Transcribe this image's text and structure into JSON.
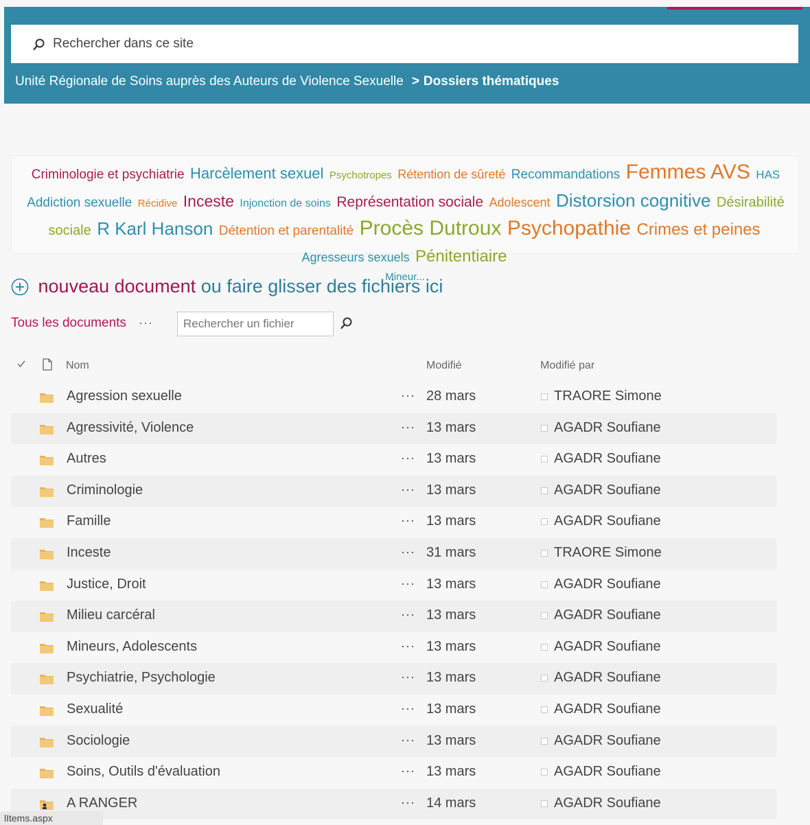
{
  "header": {
    "search_placeholder": "Rechercher dans ce site",
    "breadcrumb_site": "Unité Régionale de Soins auprès des Auteurs de Violence Sexuelle",
    "breadcrumb_sep": ">",
    "breadcrumb_current": "Dossiers thématiques"
  },
  "tagcloud": {
    "tags": [
      {
        "text": "Criminologie et psychiatrie",
        "size": 19,
        "color": "#a81d4c"
      },
      {
        "text": "Harcèlement sexuel",
        "size": 22,
        "color": "#2e8fad"
      },
      {
        "text": "Psychotropes",
        "size": 15,
        "color": "#8aa82c"
      },
      {
        "text": "Rétention de sûreté",
        "size": 18,
        "color": "#e0782a"
      },
      {
        "text": "Recommandations",
        "size": 19,
        "color": "#2e8fad"
      },
      {
        "text": "Femmes AVS",
        "size": 30,
        "color": "#e0782a"
      },
      {
        "text": "HAS",
        "size": 17,
        "color": "#2e8fad"
      },
      {
        "text": "Addiction sexuelle",
        "size": 19,
        "color": "#2e8fad"
      },
      {
        "text": "Récidive",
        "size": 15,
        "color": "#e0782a"
      },
      {
        "text": "Inceste",
        "size": 23,
        "color": "#a81d4c"
      },
      {
        "text": "Injonction de soins",
        "size": 16,
        "color": "#2e8fad"
      },
      {
        "text": "Représentation sociale",
        "size": 21,
        "color": "#a81d4c"
      },
      {
        "text": "Adolescent",
        "size": 18,
        "color": "#e0782a"
      },
      {
        "text": "Distorsion cognitive",
        "size": 26,
        "color": "#2e8fad"
      },
      {
        "text": "Désirabilité sociale",
        "size": 20,
        "color": "#8aa82c"
      },
      {
        "text": "R Karl Hanson",
        "size": 26,
        "color": "#2e8fad"
      },
      {
        "text": "Détention et parentalité",
        "size": 19,
        "color": "#e0782a"
      },
      {
        "text": "Procès Dutroux",
        "size": 30,
        "color": "#8aa82c"
      },
      {
        "text": "Psychopathie",
        "size": 30,
        "color": "#e0782a"
      },
      {
        "text": "Crimes et peines",
        "size": 24,
        "color": "#e0782a"
      },
      {
        "text": "Agresseurs sexuels",
        "size": 18,
        "color": "#2e8fad"
      },
      {
        "text": "Pénitentiaire",
        "size": 24,
        "color": "#8aa82c"
      }
    ],
    "more_label": "Mineur..."
  },
  "library": {
    "new_doc_label": "nouveau document",
    "drag_label": "ou faire glisser des fichiers ici",
    "view_label": "Tous les documents",
    "more_views": "···",
    "file_search_placeholder": "Rechercher un fichier"
  },
  "columns": {
    "name": "Nom",
    "modified": "Modifié",
    "modified_by": "Modifié par"
  },
  "rows": [
    {
      "name": "Agression sexuelle",
      "date": "28 mars",
      "user": "TRAORE Simone",
      "icon": "folder-icon"
    },
    {
      "name": "Agressivité, Violence",
      "date": "13 mars",
      "user": "AGADR Soufiane",
      "icon": "folder-icon"
    },
    {
      "name": "Autres",
      "date": "13 mars",
      "user": "AGADR Soufiane",
      "icon": "folder-icon"
    },
    {
      "name": "Criminologie",
      "date": "13 mars",
      "user": "AGADR Soufiane",
      "icon": "folder-icon"
    },
    {
      "name": "Famille",
      "date": "13 mars",
      "user": "AGADR Soufiane",
      "icon": "folder-icon"
    },
    {
      "name": "Inceste",
      "date": "31 mars",
      "user": "TRAORE Simone",
      "icon": "folder-icon"
    },
    {
      "name": "Justice, Droit",
      "date": "13 mars",
      "user": "AGADR Soufiane",
      "icon": "folder-icon"
    },
    {
      "name": "Milieu carcéral",
      "date": "13 mars",
      "user": "AGADR Soufiane",
      "icon": "folder-icon"
    },
    {
      "name": "Mineurs, Adolescents",
      "date": "13 mars",
      "user": "AGADR Soufiane",
      "icon": "folder-icon"
    },
    {
      "name": "Psychiatrie, Psychologie",
      "date": "13 mars",
      "user": "AGADR Soufiane",
      "icon": "folder-icon"
    },
    {
      "name": "Sexualité",
      "date": "13 mars",
      "user": "AGADR Soufiane",
      "icon": "folder-icon"
    },
    {
      "name": "Sociologie",
      "date": "13 mars",
      "user": "AGADR Soufiane",
      "icon": "folder-icon"
    },
    {
      "name": "Soins, Outils d'évaluation",
      "date": "13 mars",
      "user": "AGADR Soufiane",
      "icon": "folder-icon"
    },
    {
      "name": "A RANGER",
      "date": "14 mars",
      "user": "AGADR Soufiane",
      "icon": "shared-folder-icon"
    }
  ],
  "row_more": "···",
  "status_bar": "lItems.aspx"
}
